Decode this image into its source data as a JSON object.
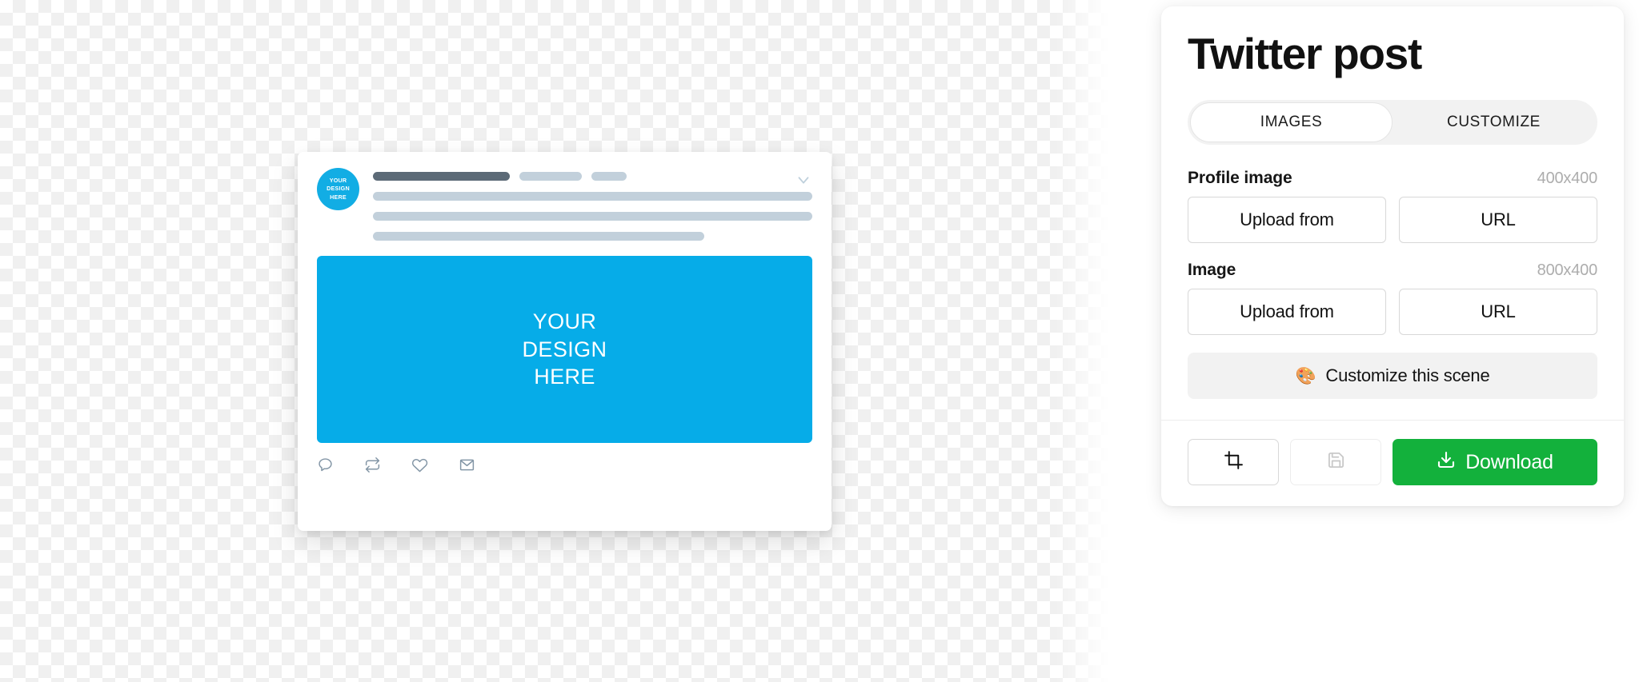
{
  "panel": {
    "title": "Twitter post",
    "tabs": [
      {
        "label": "IMAGES",
        "active": true
      },
      {
        "label": "CUSTOMIZE",
        "active": false
      }
    ],
    "fields": [
      {
        "label": "Profile image",
        "dimensions": "400x400",
        "upload_label": "Upload from",
        "url_label": "URL"
      },
      {
        "label": "Image",
        "dimensions": "800x400",
        "upload_label": "Upload from",
        "url_label": "URL"
      }
    ],
    "customize_button": {
      "emoji": "🎨",
      "label": "Customize this scene"
    },
    "footer": {
      "crop_icon": "crop-icon",
      "save_icon": "save-icon",
      "download_label": "Download",
      "download_icon": "download-icon",
      "download_color": "#13B13C"
    }
  },
  "mockup": {
    "avatar": {
      "line1": "YOUR",
      "line2": "DESIGN",
      "line3": "HERE",
      "color": "#12ADE4"
    },
    "image_placeholder": {
      "line1": "YOUR",
      "line2": "DESIGN",
      "line3": "HERE",
      "color": "#06ACE8"
    },
    "chevron_icon": "chevron-down-icon",
    "actions": [
      {
        "icon": "reply-icon"
      },
      {
        "icon": "retweet-icon"
      },
      {
        "icon": "like-icon"
      },
      {
        "icon": "share-icon"
      }
    ]
  }
}
